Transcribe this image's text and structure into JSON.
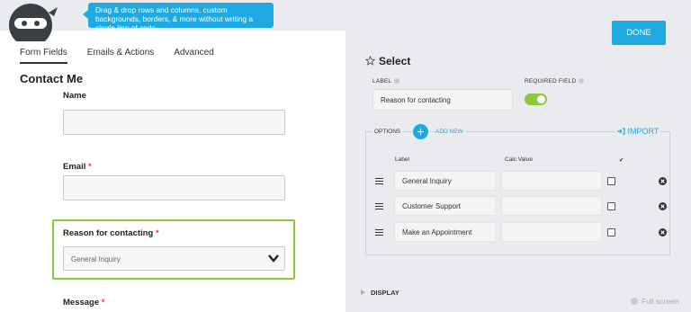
{
  "header": {
    "tooltip": "Drag & drop rows and columns, custom backgrounds, borders, & more without writing a single line of code.",
    "done_label": "DONE"
  },
  "tabs": [
    "Form Fields",
    "Emails & Actions",
    "Advanced"
  ],
  "form": {
    "title": "Contact Me",
    "fields": {
      "name_label": "Name",
      "email_label": "Email",
      "reason_label": "Reason for contacting",
      "reason_value": "General Inquiry",
      "message_label": "Message",
      "required_mark": "*"
    }
  },
  "settings": {
    "title": "Select",
    "label_caption": "LABEL",
    "label_value": "Reason for contacting",
    "required_caption": "REQUIRED FIELD",
    "required_on": true,
    "options_caption": "OPTIONS",
    "add_new": "ADD NEW",
    "import": "IMPORT",
    "col_label": "Label",
    "col_calc": "Calc Value",
    "col_check": "✔",
    "options": [
      {
        "label": "General Inquiry",
        "calc": ""
      },
      {
        "label": "Customer Support",
        "calc": ""
      },
      {
        "label": "Make an Appointment",
        "calc": ""
      }
    ],
    "display_label": "DISPLAY",
    "fullscreen": "Full screen"
  },
  "colors": {
    "accent": "#1ea9e1",
    "green": "#8dc63f",
    "required": "#e8443a"
  }
}
